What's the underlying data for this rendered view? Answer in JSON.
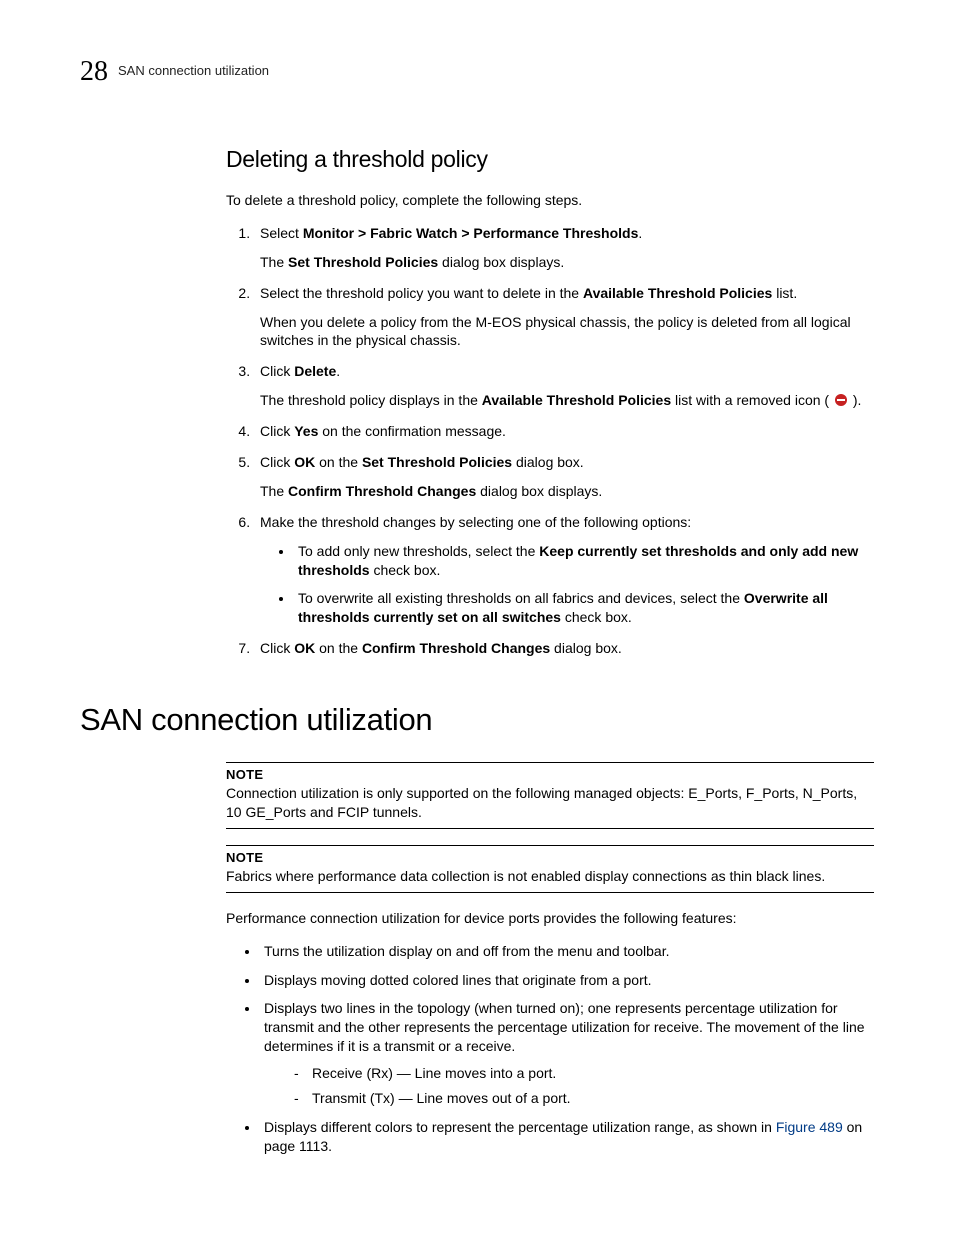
{
  "header": {
    "chapter_number": "28",
    "running_title": "SAN connection utilization"
  },
  "sub_heading": "Deleting a threshold policy",
  "intro": "To delete a threshold policy, complete the following steps.",
  "steps": {
    "s1_a": "Select ",
    "s1_b": "Monitor > Fabric Watch > Performance Thresholds",
    "s1_c": ".",
    "s1_sub_a": "The ",
    "s1_sub_b": "Set Threshold Policies",
    "s1_sub_c": " dialog box displays.",
    "s2_a": "Select the threshold policy you want to delete in the ",
    "s2_b": "Available Threshold Policies",
    "s2_c": " list.",
    "s2_sub": "When you delete a policy from the M-EOS physical chassis, the policy is deleted from all logical switches in the physical chassis.",
    "s3_a": "Click ",
    "s3_b": "Delete",
    "s3_c": ".",
    "s3_sub_a": "The threshold policy displays in the ",
    "s3_sub_b": "Available Threshold Policies",
    "s3_sub_c": " list with a removed icon ( ",
    "s3_sub_d": " ).",
    "s4_a": "Click ",
    "s4_b": "Yes",
    "s4_c": " on the confirmation message.",
    "s5_a": "Click ",
    "s5_b": "OK",
    "s5_c": " on the ",
    "s5_d": "Set Threshold Policies",
    "s5_e": " dialog box.",
    "s5_sub_a": "The ",
    "s5_sub_b": "Confirm Threshold Changes",
    "s5_sub_c": " dialog box displays.",
    "s6": "Make the threshold changes by selecting one of the following options:",
    "s6_b1_a": "To add only new thresholds, select the ",
    "s6_b1_b": "Keep currently set thresholds and only add new thresholds",
    "s6_b1_c": " check box.",
    "s6_b2_a": "To overwrite all existing thresholds on all fabrics and devices, select the ",
    "s6_b2_b": "Overwrite all thresholds currently set on all switches",
    "s6_b2_c": " check box.",
    "s7_a": "Click ",
    "s7_b": "OK",
    "s7_c": " on the ",
    "s7_d": "Confirm Threshold Changes",
    "s7_e": " dialog box."
  },
  "section_heading": "SAN connection utilization",
  "note_label": "NOTE",
  "note1": "Connection utilization is only supported on the following managed objects: E_Ports, F_Ports, N_Ports, 10 GE_Ports and FCIP tunnels.",
  "note2": "Fabrics where performance data collection is not enabled display connections as thin black lines.",
  "features_intro": "Performance connection utilization for device ports provides the following features:",
  "features": {
    "f1": "Turns the utilization display on and off from the menu and toolbar.",
    "f2": "Displays moving dotted colored lines that originate from a port.",
    "f3": "Displays two lines in the topology (when turned on); one represents percentage utilization for transmit and the other represents the percentage utilization for receive. The movement of the line determines if it is a transmit or a receive.",
    "f3_d1": "Receive (Rx) — Line moves into a port.",
    "f3_d2": "Transmit (Tx) — Line moves out of a port.",
    "f4_a": "Displays different colors to represent the percentage utilization range, as shown in ",
    "f4_link": "Figure 489",
    "f4_b": " on page 1113."
  }
}
